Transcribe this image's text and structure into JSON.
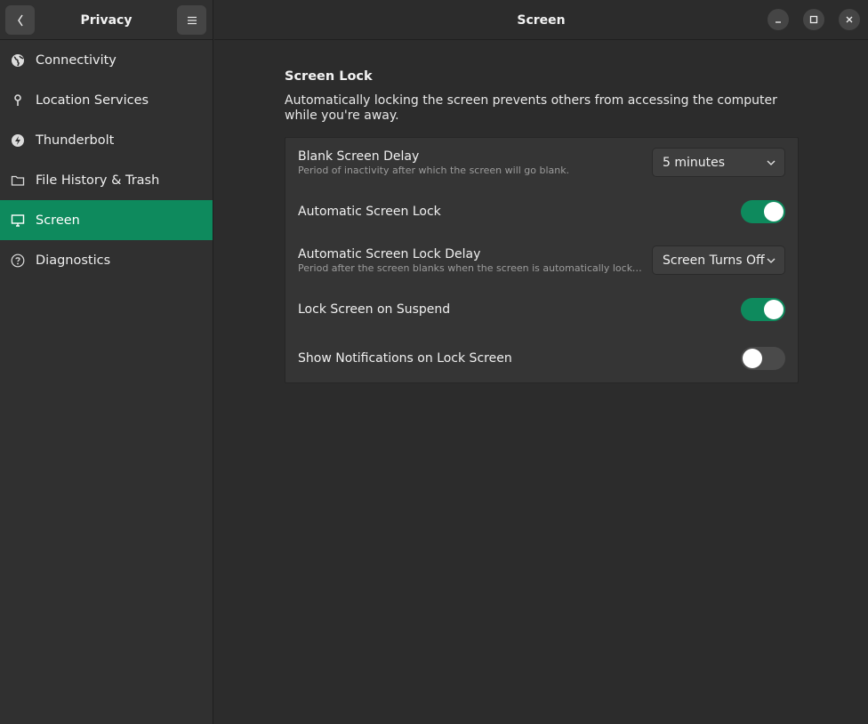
{
  "sidebar": {
    "title": "Privacy",
    "items": [
      {
        "label": "Connectivity",
        "icon": "globe-icon"
      },
      {
        "label": "Location Services",
        "icon": "location-pin-icon"
      },
      {
        "label": "Thunderbolt",
        "icon": "thunderbolt-icon"
      },
      {
        "label": "File History & Trash",
        "icon": "folder-icon"
      },
      {
        "label": "Screen",
        "icon": "monitor-icon",
        "active": true
      },
      {
        "label": "Diagnostics",
        "icon": "help-circle-icon"
      }
    ]
  },
  "header": {
    "title": "Screen"
  },
  "section": {
    "title": "Screen Lock",
    "description": "Automatically locking the screen prevents others from accessing the computer while you're away."
  },
  "settings": {
    "blank_delay": {
      "label": "Blank Screen Delay",
      "sub": "Period of inactivity after which the screen will go blank.",
      "value": "5 minutes"
    },
    "auto_lock": {
      "label": "Automatic Screen Lock",
      "state": "on"
    },
    "auto_lock_delay": {
      "label": "Automatic Screen Lock Delay",
      "sub": "Period after the screen blanks when the screen is automatically locked.",
      "value": "Screen Turns Off"
    },
    "lock_on_suspend": {
      "label": "Lock Screen on Suspend",
      "state": "on"
    },
    "show_notifications": {
      "label": "Show Notifications on Lock Screen",
      "state": "off"
    }
  },
  "colors": {
    "accent": "#0e8a5d",
    "background": "#2c2c2c",
    "sidebar": "#303030"
  }
}
